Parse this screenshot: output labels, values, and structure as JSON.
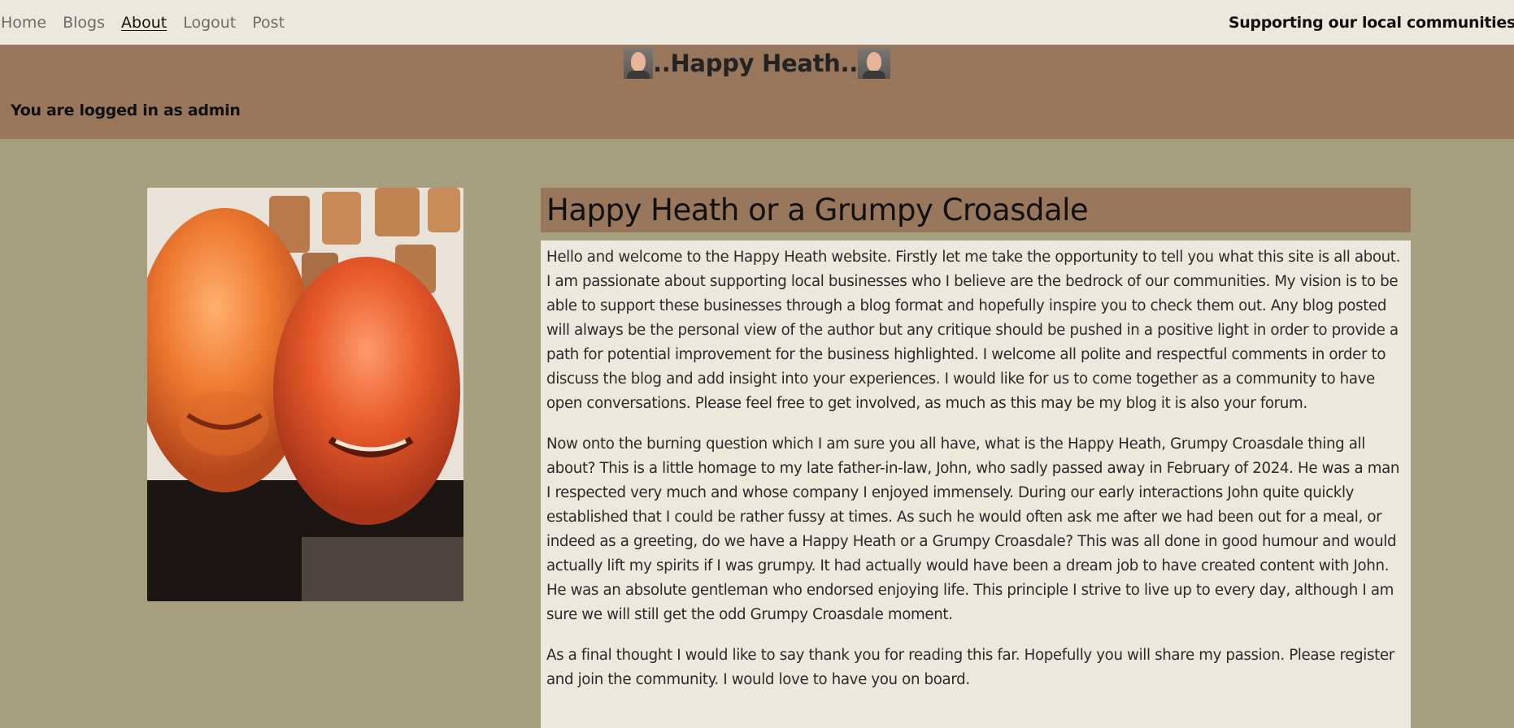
{
  "nav": {
    "items": [
      {
        "label": "Home",
        "active": false
      },
      {
        "label": "Blogs",
        "active": false
      },
      {
        "label": "About",
        "active": true
      },
      {
        "label": "Logout",
        "active": false
      },
      {
        "label": "Post",
        "active": false
      }
    ],
    "tagline": "Supporting our local communities"
  },
  "banner": {
    "title": "..Happy Heath..",
    "avatar_icon": "bald-man-avatar-icon",
    "logged_in_text": "You are logged in as admin"
  },
  "article": {
    "heading": "Happy Heath or a Grumpy Croasdale",
    "paragraphs": [
      "Hello and welcome to the Happy Heath website. Firstly let me take the opportunity to tell you what this site is all about. I am passionate about supporting local businesses who I believe are the bedrock of our communities. My vision is to be able to support these businesses through a blog format and hopefully inspire you to check them out. Any blog posted will always be the personal view of the author but any critique should be pushed in a positive light in order to provide a path for potential improvement for the business highlighted. I welcome all polite and respectful comments in order to discuss the blog and add insight into your experiences. I would like for us to come together as a community to have open conversations. Please feel free to get involved, as much as this may be my blog it is also your forum.",
      "Now onto the burning question which I am sure you all have, what is the Happy Heath, Grumpy Croasdale thing all about? This is a little homage to my late father-in-law, John, who sadly passed away in February of 2024. He was a man I respected very much and whose company I enjoyed immensely. During our early interactions John quite quickly established that I could be rather fussy at times. As such he would often ask me after we had been out for a meal, or indeed as a greeting, do we have a Happy Heath or a Grumpy Croasdale? This was all done in good humour and would actually lift my spirits if I was grumpy. It had actually would have been a dream job to have created content with John. He was an absolute gentleman who endorsed enjoying life. This principle I strive to live up to every day, although I am sure we will still get the odd Grumpy Croasdale moment.",
      "As a final thought I would like to say thank you for reading this far. Hopefully you will share my passion. Please register and join the community. I would love to have you on board."
    ]
  },
  "colors": {
    "navbar_bg": "#ebe8dd",
    "banner_bg": "#98775d",
    "page_bg": "#a59e7f",
    "article_bg": "#ebe8dd"
  }
}
